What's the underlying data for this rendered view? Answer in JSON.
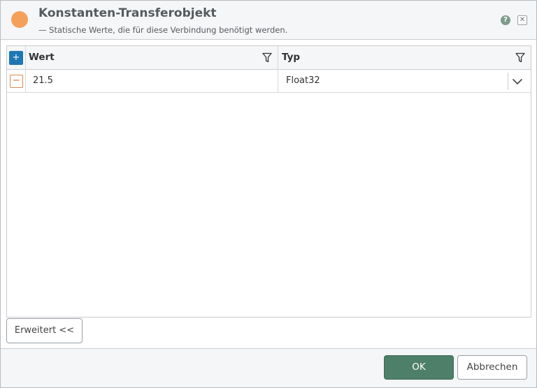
{
  "dialog": {
    "title": "Konstanten-Transferobjekt",
    "subtitle": "— Statische Werte, die für diese Verbindung benötigt werden.",
    "header_dot_color": "#f5a05a",
    "help_icon": "help-icon",
    "help_glyph": "?",
    "close_icon": "close-icon",
    "close_glyph": "✕"
  },
  "grid": {
    "add_glyph": "+",
    "columns": [
      {
        "label": "Wert",
        "filter_icon": "filter-icon"
      },
      {
        "label": "Typ",
        "filter_icon": "filter-icon"
      }
    ],
    "rows": [
      {
        "remove_glyph": "−",
        "value": "21.5",
        "type": "Float32",
        "type_dropdown_icon": "chevron-down-icon"
      }
    ]
  },
  "advanced_button": {
    "label": "Erweitert <<"
  },
  "footer": {
    "ok_label": "OK",
    "cancel_label": "Abbrechen"
  },
  "colors": {
    "accent_blue": "#1e78b4",
    "ok_green": "#4e7f68",
    "remove_orange": "#d06a2c"
  }
}
